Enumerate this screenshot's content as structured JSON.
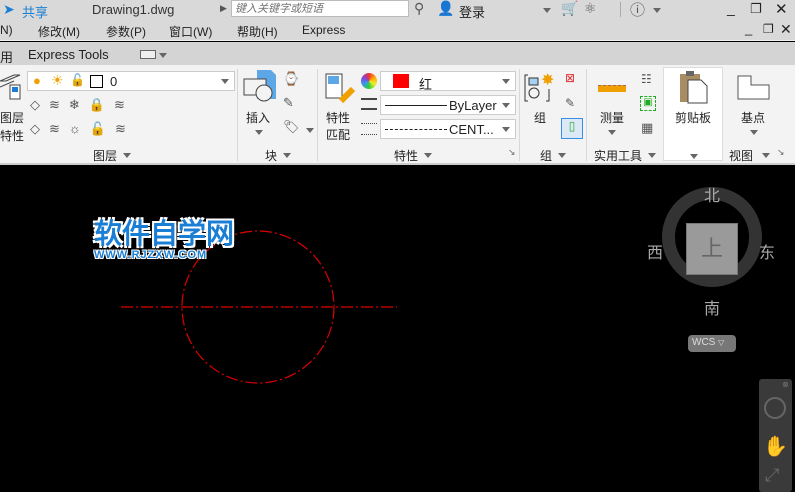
{
  "titlebar": {
    "share": "共享",
    "filename": "Drawing1.dwg",
    "search_placeholder": "键入关键字或短语",
    "login": "登录"
  },
  "menu": [
    "N)",
    "修改(M)",
    "参数(P)",
    "窗口(W)",
    "帮助(H)",
    "Express"
  ],
  "tabs": [
    "用",
    "Express Tools"
  ],
  "ribbon": {
    "layer": {
      "label": "图层",
      "props_btn": "图层\n特性",
      "props_l1": "图层",
      "props_l2": "特性",
      "current_layer": "0"
    },
    "block": {
      "label": "块",
      "insert": "插入"
    },
    "properties": {
      "label": "特性",
      "match_l1": "特性",
      "match_l2": "匹配",
      "color": "红",
      "linetype": "ByLayer",
      "linetype2": "CENT...",
      "color_hex": "#ff0000"
    },
    "group": {
      "label": "组",
      "group_btn": "组"
    },
    "utilities": {
      "label": "实用工具",
      "measure": "测量"
    },
    "clipboard": {
      "label": "剪贴板"
    },
    "view": {
      "label": "视图",
      "basepoint": "基点"
    }
  },
  "viewcube": {
    "north": "北",
    "south": "南",
    "east": "东",
    "west": "西",
    "top": "上",
    "wcs": "WCS"
  },
  "watermark": {
    "title": "软件自学网",
    "url": "WWW.RJZXW.COM"
  }
}
